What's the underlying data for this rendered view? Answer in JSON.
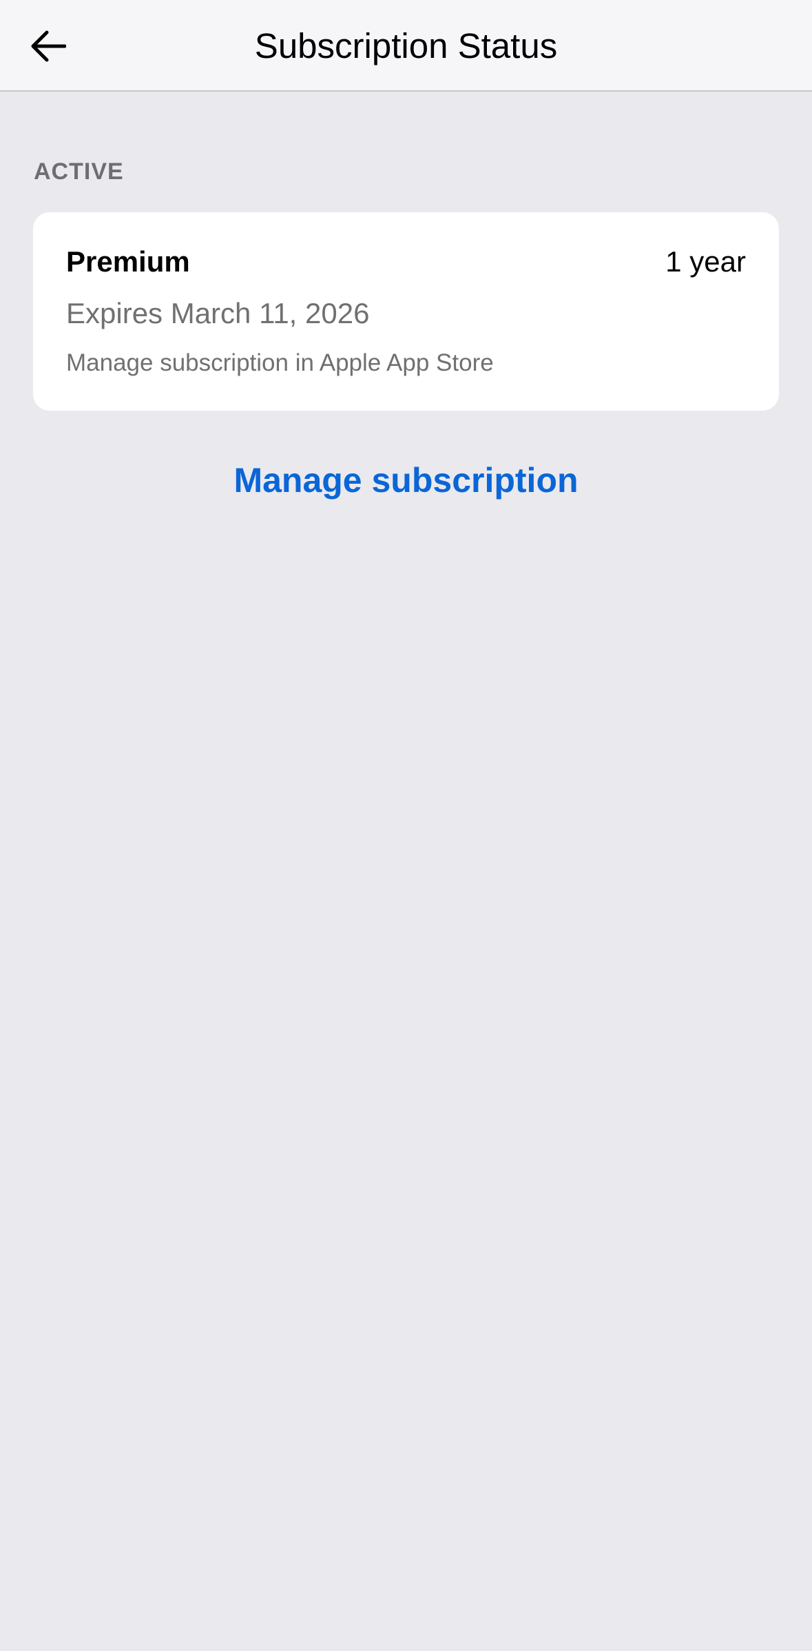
{
  "nav": {
    "title": "Subscription Status",
    "back_icon": "arrow-left-icon"
  },
  "section": {
    "header": "ACTIVE"
  },
  "subscription": {
    "plan": "Premium",
    "duration": "1 year",
    "expiry": "Expires March 11, 2026",
    "note": "Manage subscription in Apple App Store"
  },
  "actions": {
    "manage_label": "Manage subscription"
  },
  "colors": {
    "background": "#e9e9ee",
    "nav_background": "#f6f6f8",
    "card_background": "#ffffff",
    "link": "#0a66d6",
    "secondary_text": "#707070",
    "section_header": "#6d6d72"
  }
}
